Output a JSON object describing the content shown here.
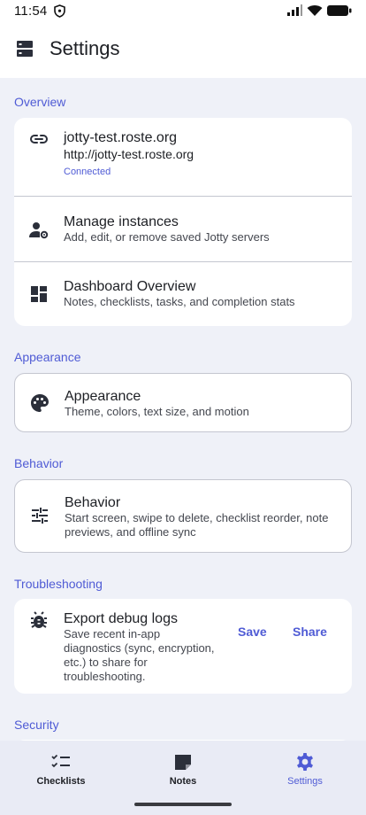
{
  "status": {
    "time": "11:54"
  },
  "app_bar": {
    "title": "Settings"
  },
  "sections": {
    "overview": "Overview",
    "appearance": "Appearance",
    "behavior": "Behavior",
    "troubleshooting": "Troubleshooting",
    "security": "Security"
  },
  "overview": {
    "instance": {
      "name": "jotty-test.roste.org",
      "url": "http://jotty-test.roste.org",
      "status": "Connected"
    },
    "manage": {
      "title": "Manage instances",
      "subtitle": "Add, edit, or remove saved Jotty servers"
    },
    "dashboard": {
      "title": "Dashboard Overview",
      "subtitle": "Notes, checklists, tasks, and completion stats"
    }
  },
  "appearance": {
    "title": "Appearance",
    "subtitle": "Theme, colors, text size, and motion"
  },
  "behavior": {
    "title": "Behavior",
    "subtitle": "Start screen, swipe to delete, checklist reorder, note previews, and offline sync"
  },
  "troubleshooting": {
    "title": "Export debug logs",
    "subtitle": "Save recent in-app diagnostics (sync, encryption, etc.) to share for troubleshooting.",
    "save_label": "Save",
    "share_label": "Share"
  },
  "bottom_nav": {
    "items": [
      {
        "label": "Checklists",
        "icon": "checklist-icon"
      },
      {
        "label": "Notes",
        "icon": "note-icon"
      },
      {
        "label": "Settings",
        "icon": "gear-icon"
      }
    ],
    "active": "Settings"
  },
  "colors": {
    "accent": "#4f5bd5",
    "background": "#eff1f8",
    "card": "#ffffff",
    "nav": "#e9ebf5"
  }
}
